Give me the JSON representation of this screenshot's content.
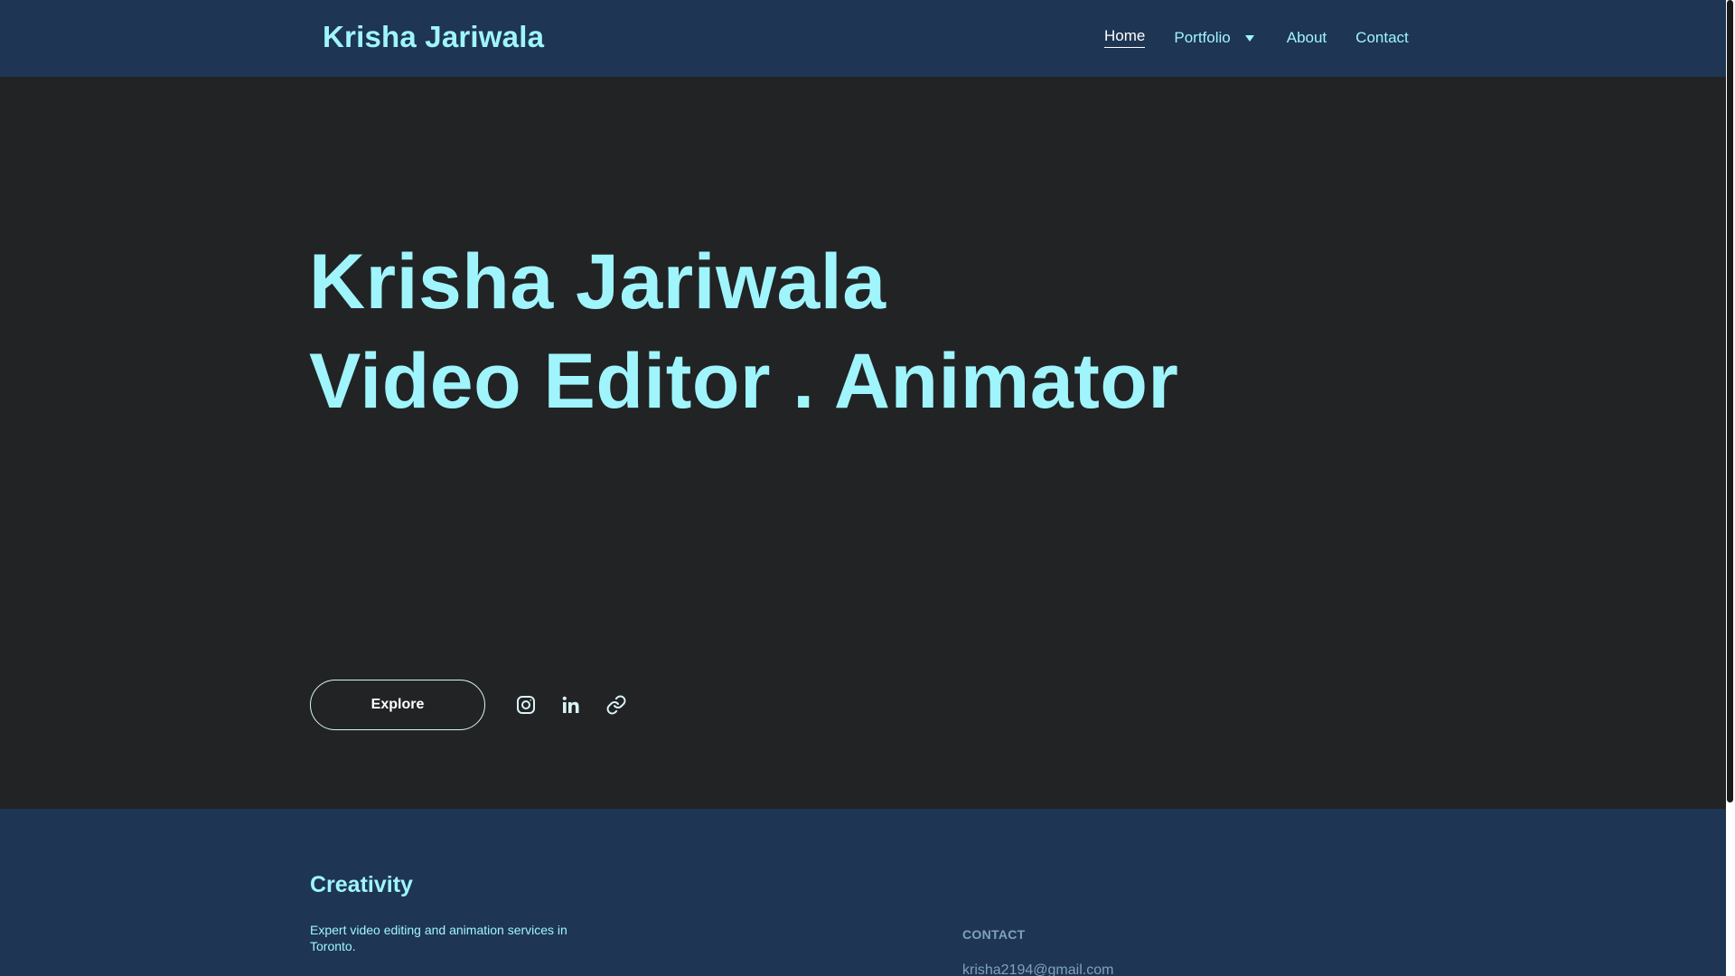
{
  "header": {
    "brand": "Krisha Jariwala",
    "nav": {
      "home": "Home",
      "portfolio": "Portfolio",
      "about": "About",
      "contact": "Contact"
    }
  },
  "hero": {
    "title_line1": "Krisha Jariwala",
    "title_line2": "Video Editor . Animator",
    "explore_label": "Explore",
    "social_icons": [
      "instagram-icon",
      "linkedin-icon",
      "link-icon"
    ]
  },
  "footer": {
    "title": "Creativity",
    "description": "Expert video editing and animation services in Toronto.",
    "contact_label": "CONTACT",
    "email": "krisha2194@gmail.com"
  },
  "colors": {
    "nav_bg": "#1e3554",
    "hero_bg": "#222325",
    "accent": "#9ff5fb",
    "muted": "#7fa3b8"
  }
}
